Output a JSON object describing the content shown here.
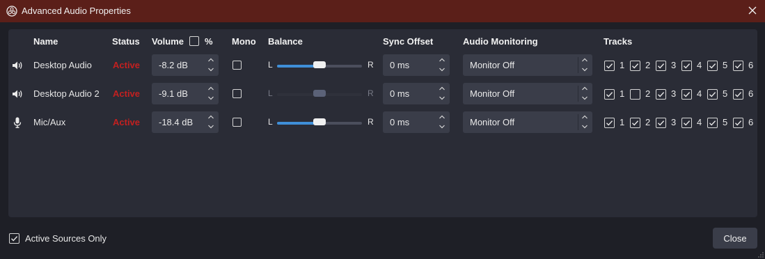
{
  "window": {
    "title": "Advanced Audio Properties"
  },
  "headers": {
    "name": "Name",
    "status": "Status",
    "volume": "Volume",
    "percent": "%",
    "mono": "Mono",
    "balance": "Balance",
    "sync_offset": "Sync Offset",
    "audio_monitoring": "Audio Monitoring",
    "tracks": "Tracks"
  },
  "balance_labels": {
    "left": "L",
    "right": "R"
  },
  "rows": [
    {
      "icon": "speaker-icon",
      "name": "Desktop Audio",
      "status": "Active",
      "volume": "-8.2 dB",
      "mono": false,
      "balance_enabled": true,
      "balance": 0.5,
      "sync": "0 ms",
      "monitoring": "Monitor Off",
      "tracks": [
        {
          "label": "1",
          "checked": true
        },
        {
          "label": "2",
          "checked": true
        },
        {
          "label": "3",
          "checked": true
        },
        {
          "label": "4",
          "checked": true
        },
        {
          "label": "5",
          "checked": true
        },
        {
          "label": "6",
          "checked": true
        }
      ]
    },
    {
      "icon": "speaker-icon",
      "name": "Desktop Audio 2",
      "status": "Active",
      "volume": "-9.1 dB",
      "mono": false,
      "balance_enabled": false,
      "balance": 0.5,
      "sync": "0 ms",
      "monitoring": "Monitor Off",
      "tracks": [
        {
          "label": "1",
          "checked": true
        },
        {
          "label": "2",
          "checked": false
        },
        {
          "label": "3",
          "checked": true
        },
        {
          "label": "4",
          "checked": true
        },
        {
          "label": "5",
          "checked": true
        },
        {
          "label": "6",
          "checked": true
        }
      ]
    },
    {
      "icon": "microphone-icon",
      "name": "Mic/Aux",
      "status": "Active",
      "volume": "-18.4 dB",
      "mono": false,
      "balance_enabled": true,
      "balance": 0.5,
      "sync": "0 ms",
      "monitoring": "Monitor Off",
      "tracks": [
        {
          "label": "1",
          "checked": true
        },
        {
          "label": "2",
          "checked": true
        },
        {
          "label": "3",
          "checked": true
        },
        {
          "label": "4",
          "checked": true
        },
        {
          "label": "5",
          "checked": true
        },
        {
          "label": "6",
          "checked": true
        }
      ]
    }
  ],
  "footer": {
    "active_sources_only_label": "Active Sources Only",
    "active_sources_only": true,
    "close_label": "Close"
  },
  "colors": {
    "titlebar": "#5b1f19",
    "status_active": "#c32020",
    "accent": "#3f8fd8"
  }
}
